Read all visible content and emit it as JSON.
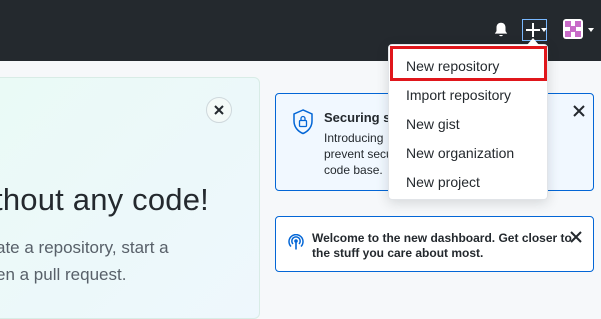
{
  "header": {
    "icons": [
      "bell-icon",
      "plus-icon",
      "chevron-down-icon",
      "avatar"
    ]
  },
  "new_menu": {
    "items": [
      {
        "label": "New repository"
      },
      {
        "label": "Import repository"
      },
      {
        "label": "New gist"
      },
      {
        "label": "New organization"
      },
      {
        "label": "New project"
      }
    ],
    "highlight_color": "#e0161b"
  },
  "hero": {
    "headline": "thout any code!",
    "subtext_lines": [
      "ate a repository, start a",
      "en a pull request."
    ]
  },
  "security_card": {
    "title": "Securing s",
    "body_lines": [
      "Introducing",
      "prevent secu",
      "code base."
    ]
  },
  "welcome_card": {
    "lines": [
      "Welcome to the new dashboard. Get closer to",
      "the stuff you care about most."
    ]
  },
  "colors": {
    "header_bg": "#24292e",
    "accent_blue": "#0366d6",
    "page_bg": "#f6f8fa"
  }
}
